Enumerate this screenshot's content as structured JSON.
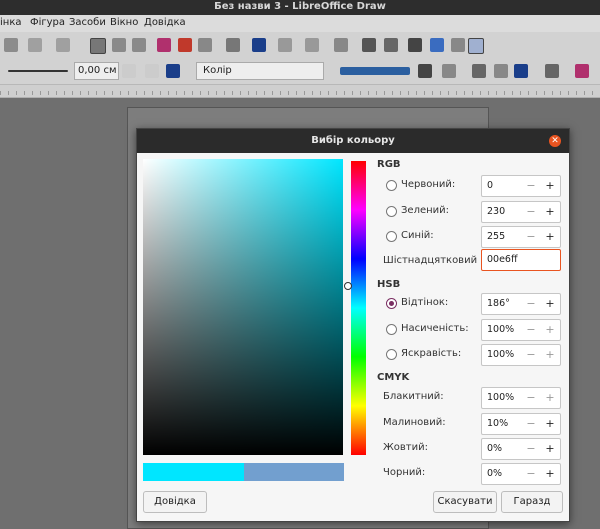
{
  "window": {
    "title": "Без назви 3 - LibreOffice Draw"
  },
  "menubar": {
    "items": [
      "інка",
      "Фігура",
      "Засоби",
      "Вікно",
      "Довідка"
    ]
  },
  "toolbar": {
    "line_width": "0,00 см",
    "fill_type": "Колір"
  },
  "dialog": {
    "title": "Вибір кольору",
    "rgb": {
      "heading": "RGB",
      "red_label": "Червоний:",
      "red_value": "0",
      "green_label": "Зелений:",
      "green_value": "230",
      "blue_label": "Синій:",
      "blue_value": "255",
      "hex_label": "Шістнадцятковий #:",
      "hex_value": "00e6ff"
    },
    "hsb": {
      "heading": "HSB",
      "hue_label": "Відтінок:",
      "hue_value": "186°",
      "sat_label": "Насиченість:",
      "sat_value": "100%",
      "bri_label": "Яскравість:",
      "bri_value": "100%"
    },
    "cmyk": {
      "heading": "CMYK",
      "cyan_label": "Блакитний:",
      "cyan_value": "100%",
      "magenta_label": "Малиновий:",
      "magenta_value": "10%",
      "yellow_label": "Жовтий:",
      "yellow_value": "0%",
      "black_label": "Чорний:",
      "black_value": "0%"
    },
    "buttons": {
      "help": "Довідка",
      "cancel": "Скасувати",
      "ok": "Гаразд"
    },
    "colors": {
      "new": "#00e6ff",
      "old": "#729fcf"
    }
  }
}
